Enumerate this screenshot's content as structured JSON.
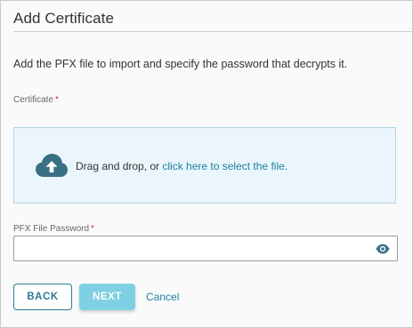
{
  "dialog": {
    "title": "Add Certificate",
    "description": "Add the PFX file to import and specify the password that decrypts it."
  },
  "certificate": {
    "label": "Certificate",
    "required_marker": "*",
    "dropzone_text": "Drag and drop, or ",
    "dropzone_link": "click here to select the file.",
    "icon": "cloud-upload-icon"
  },
  "password": {
    "label": "PFX File Password",
    "required_marker": "*",
    "value": "",
    "placeholder": "",
    "toggle_icon": "eye-icon"
  },
  "actions": {
    "back_label": "BACK",
    "next_label": "NEXT",
    "cancel_label": "Cancel"
  },
  "colors": {
    "accent": "#1d7fa3",
    "required": "#d0263e",
    "dropzone_bg": "#eaf6fb",
    "next_bg": "#7fd0e3",
    "back_border": "#2b7a96"
  }
}
